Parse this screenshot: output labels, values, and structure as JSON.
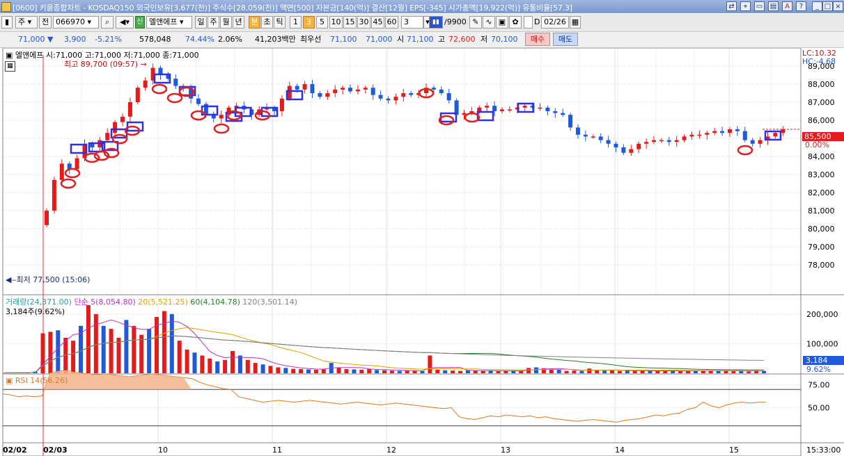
{
  "window": {
    "title": "[0600] 키움종합차트 - KOSDAQ150 외국인보유[3,677(천)] 주식수[28,059(천)] 액면[500] 자본금[140(억)] 결산[12월] EPS[-345] 시가총액[19,922(억)] 유통비율[57.3]"
  },
  "toolbar": {
    "type_sel": "주",
    "all_btn": "전",
    "code": "066970",
    "badge_sin": "신",
    "stock_name": "엘앤에프",
    "periods": [
      "일",
      "주",
      "월",
      "년",
      "분",
      "초",
      "틱"
    ],
    "active_period": "분",
    "intervals": [
      "1",
      "3",
      "5",
      "10",
      "15",
      "30",
      "45",
      "60"
    ],
    "active_interval": "3",
    "count_value": "3",
    "count_of": "/9900",
    "date_prefix": "D",
    "date_value": "02/26"
  },
  "quote": {
    "price": "71,000",
    "change": "3,900",
    "change_pct": "-5.21%",
    "volume": "578,048",
    "vol_ratio": "74.44%",
    "turnover": "2.06%",
    "amount": "41,203백만",
    "pri_label": "최우선",
    "pri_ask": "71,100",
    "pri_bid": "71,000",
    "open_label": "시",
    "open": "71,100",
    "high_label": "고",
    "high": "72,600",
    "low_label": "저",
    "low": "70,100",
    "buy_btn": "매수",
    "sell_btn": "매도"
  },
  "price_panel": {
    "header": "엘앤에프 시:71,000 고:71,000 저:71,000 종:71,000",
    "max_label": "최고 89,700 (09:57)",
    "min_label": "최저 77,500 (15:06)",
    "lc": "LC:10.32",
    "hc": "HC:-4.68",
    "last_price": "85,500",
    "last_pct": "0.00%",
    "yticks": [
      "89,000",
      "88,000",
      "87,000",
      "86,000",
      "85,000",
      "84,000",
      "83,000",
      "82,000",
      "81,000",
      "80,000",
      "79,000",
      "78,000"
    ]
  },
  "volume_panel": {
    "header_vol": "거래량(24,371.00)",
    "header_ma5": "단순 5(8,054.80)",
    "header_ma20": "20(5,521.25)",
    "header_ma60": "60(4,104.78)",
    "header_ma120": "120(3,501.14)",
    "sub": "3,184주(9.62%)",
    "yticks": [
      "200,000",
      "100,000"
    ],
    "last_vol": "3,184",
    "last_pct": "9.62%"
  },
  "rsi_panel": {
    "header": "RSI 14(56.26)",
    "yticks": [
      "75.00",
      "50.00"
    ]
  },
  "xaxis": {
    "labels": [
      "02/03",
      "10",
      "11",
      "12",
      "13",
      "14",
      "15"
    ],
    "left_label": "02/02",
    "time_label": "15:33:00"
  },
  "colors": {
    "up": "#e21b1b",
    "down": "#1f5ad7",
    "ma5": "#c030c0",
    "ma20": "#e0a000",
    "ma60": "#208020",
    "ma120": "#808080",
    "rsi": "#e07820",
    "mark": "#3030e0",
    "title_bg": "#7b97cf"
  },
  "chart_data": {
    "type": "candlestick",
    "unit": "KRW",
    "ylim": [
      77200,
      89700
    ],
    "candles_close": [
      81000,
      82700,
      83600,
      83300,
      83900,
      84700,
      84500,
      84900,
      85300,
      85900,
      86200,
      87000,
      87800,
      88200,
      88900,
      88500,
      88300,
      87900,
      87800,
      87200,
      86900,
      86300,
      86100,
      86300,
      86700,
      86800,
      86600,
      86300,
      86600,
      86700,
      86500,
      87200,
      87900,
      87700,
      88000,
      87500,
      87300,
      87500,
      87700,
      87800,
      87600,
      87700,
      87800,
      87400,
      87200,
      87100,
      87300,
      87500,
      87400,
      87500,
      87800,
      87700,
      87500,
      87100,
      86300,
      86400,
      86500,
      86700,
      86800,
      86500,
      86600,
      86600,
      86700,
      86800,
      86700,
      86700,
      86500,
      86400,
      86300,
      85600,
      85200,
      85100,
      85100,
      84900,
      84700,
      84500,
      84200,
      84400,
      84700,
      84800,
      84900,
      84900,
      84800,
      84900,
      85100,
      85200,
      85200,
      85300,
      85400,
      85300,
      85500,
      85400,
      84900,
      84700,
      84900,
      85100,
      85300,
      85500
    ],
    "volume_max": 230000,
    "rsi_last": 56.26
  }
}
